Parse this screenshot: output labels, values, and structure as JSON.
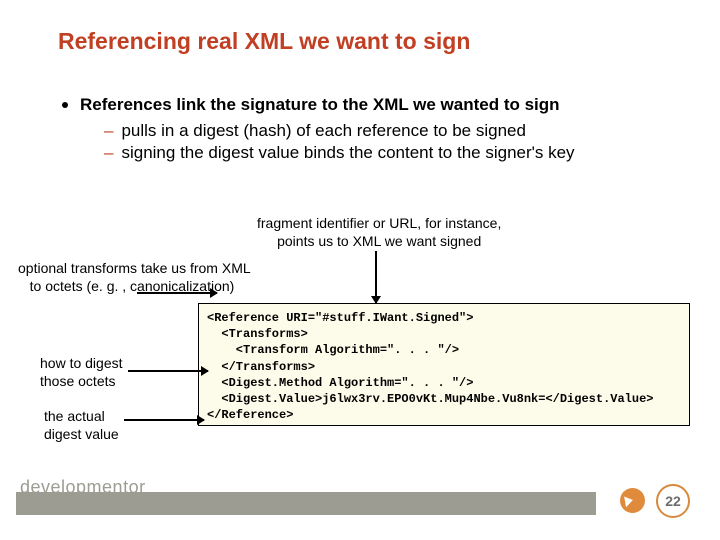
{
  "title": "Referencing real XML we want to sign",
  "bullet_main": "References link the signature to the XML we wanted to sign",
  "sub1": "pulls in a digest (hash) of each reference to be signed",
  "sub2": "signing the digest value binds the content to the signer's key",
  "labels": {
    "fragment": "fragment identifier or URL, for instance,\npoints us to XML we want signed",
    "transforms": "optional transforms take us from XML\n   to octets (e. g. , canonicalization)",
    "digest": "how to digest\nthose octets",
    "value": "the actual\ndigest value"
  },
  "code": "<Reference URI=\"#stuff.IWant.Signed\">\n  <Transforms>\n    <Transform Algorithm=\". . . \"/>\n  </Transforms>\n  <Digest.Method Algorithm=\". . . \"/>\n  <Digest.Value>j6lwx3rv.EPO0vKt.Mup4Nbe.Vu8nk=</Digest.Value>\n</Reference>",
  "footer": {
    "logo": "developmentor",
    "page": "22"
  }
}
